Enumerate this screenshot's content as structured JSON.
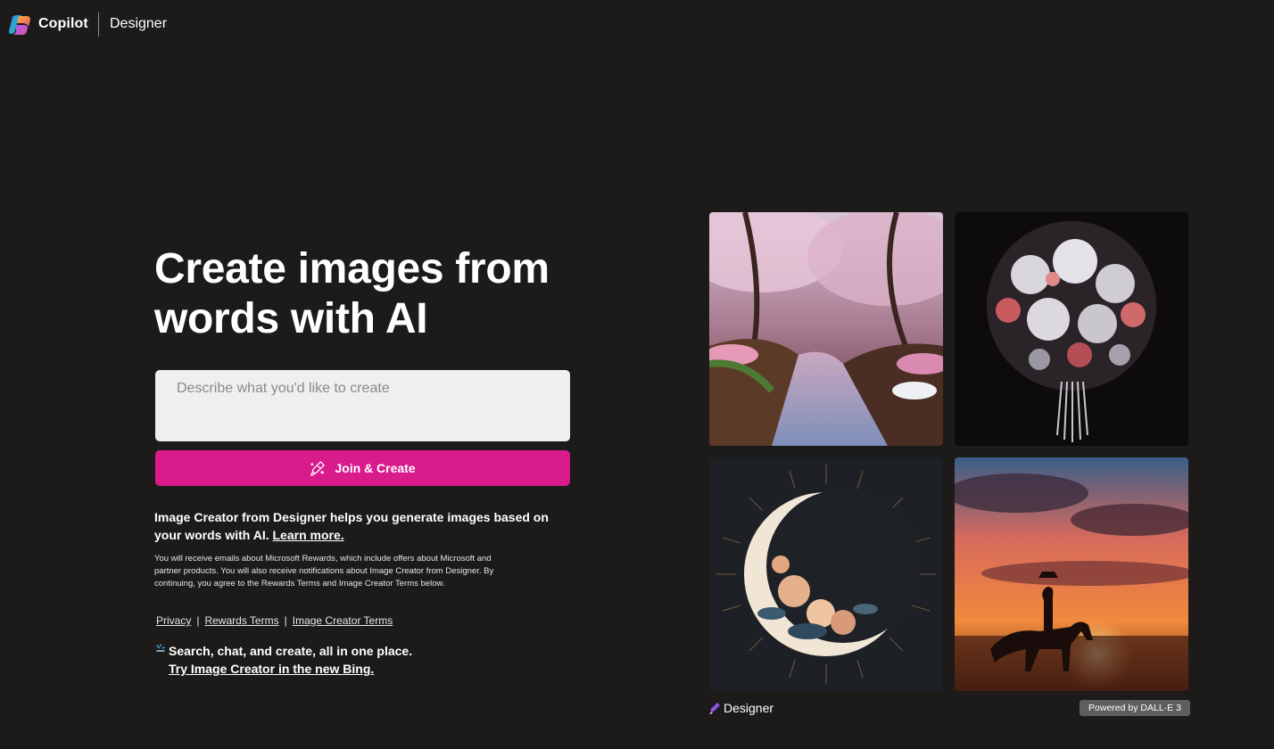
{
  "header": {
    "brand": "Copilot",
    "product": "Designer"
  },
  "hero": {
    "title_line1": "Create images from",
    "title_line2": "words with AI"
  },
  "prompt": {
    "placeholder": "Describe what you'd like to create"
  },
  "cta": {
    "label": "Join & Create"
  },
  "description": {
    "text": "Image Creator from Designer helps you generate images based on your words with AI.",
    "learn_more": "Learn more."
  },
  "fine_print": "You will receive emails about Microsoft Rewards, which include offers about Microsoft and partner products. You will also receive notifications about Image Creator from Designer. By continuing, you agree to the Rewards Terms and Image Creator Terms below.",
  "legal": {
    "privacy": "Privacy",
    "separator": "|",
    "rewards_terms": "Rewards Terms",
    "image_creator_terms": "Image Creator Terms"
  },
  "promo": {
    "text": "Search, chat, and create, all in one place.",
    "link": "Try Image Creator in the new Bing."
  },
  "gallery": {
    "footer_brand": "Designer",
    "badge": "Powered by DALL·E 3"
  },
  "colors": {
    "background": "#1c1b1a",
    "accent": "#d91b8c",
    "input_bg": "#efefef"
  }
}
